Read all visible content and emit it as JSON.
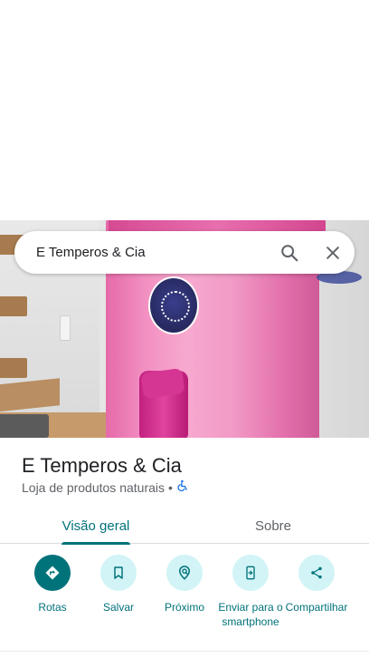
{
  "search": {
    "query": "E Temperos & Cia"
  },
  "place": {
    "title": "E Temperos & Cia",
    "category": "Loja de produtos naturais",
    "separator": "•"
  },
  "tabs": [
    {
      "label": "Visão geral",
      "selected": true
    },
    {
      "label": "Sobre",
      "selected": false
    }
  ],
  "actions": [
    {
      "label": "Rotas",
      "icon": "directions-icon"
    },
    {
      "label": "Salvar",
      "icon": "bookmark-icon"
    },
    {
      "label": "Próximo",
      "icon": "nearby-icon"
    },
    {
      "label": "Enviar para o smartphone",
      "icon": "send-to-phone-icon"
    },
    {
      "label": "Compartilhar",
      "icon": "share-icon"
    }
  ],
  "colors": {
    "accent": "#00727a",
    "accent_light": "#d2f4f6",
    "accessibility": "#1a73e8"
  }
}
